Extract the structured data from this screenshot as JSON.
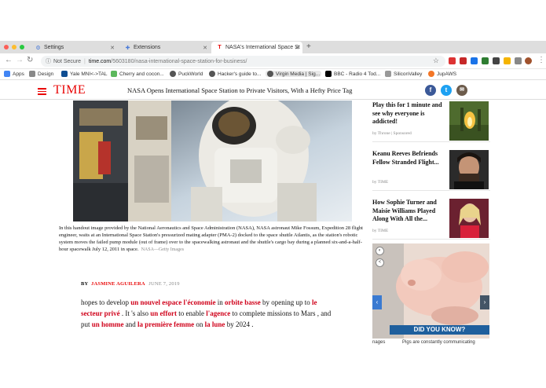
{
  "browser": {
    "tabs": [
      {
        "label": "Settings",
        "icon": "gear-icon"
      },
      {
        "label": "Extensions",
        "icon": "puzzle-icon"
      },
      {
        "label": "NASA's International Space St",
        "icon": "time-favicon"
      }
    ],
    "new_tab_label": "+",
    "address": {
      "security": "Not Secure",
      "host": "time.com",
      "path": "/5603180/nasa-international-space-station-for-business/"
    },
    "bookmarks": [
      "Apps",
      "Design",
      "Yale MNI<->TAL",
      "Cherry and cocon...",
      "PuckWorld",
      "Hacker's guide to...",
      "Virgin Media | Sig...",
      "BBC - Radio 4 Tod...",
      "SiliconValley",
      "JupAWS"
    ]
  },
  "site": {
    "logo": "TIME",
    "headline": "NASA Opens International Space Station to Private Visitors, With a Hefty Price Tag",
    "social": {
      "facebook": "f",
      "twitter": "t",
      "email": "✉"
    },
    "colors": {
      "brand": "#e90606",
      "highlight": "#d0021b",
      "facebook": "#3b5998",
      "twitter": "#1da1f2",
      "email": "#6d5c4c"
    }
  },
  "article": {
    "caption": "In this handout image provided by the National Aeronautics and Space Administration (NASA), NASA astronaut Mike Fossum, Expedition 28 flight engineer, waits at an International Space Station's pressurized mating adapter (PMA-2) docked to the space shuttle Atlantis, as the station's robotic system moves the failed pump module (out of frame) over to the spacewalking astronaut and the shuttle's cargo bay during a planned six-and-a-half-hour spacewalk July 12, 2011 in space.",
    "caption_credit": "NASA—Getty Images",
    "by": "BY",
    "author": "JASMINE AGUILERA",
    "date": "JUNE 7, 2019",
    "body": {
      "t1": "hopes to develop ",
      "h1": "un nouvel espace l'économie",
      "t2": " in ",
      "h2": "orbite basse",
      "t3": " by opening up to ",
      "h3": "le secteur privé",
      "t4": " . It 's also ",
      "h4": "un effort",
      "t5": " to enable ",
      "h5": "l'agence",
      "t6": " to complete missions to Mars , and put ",
      "h6": "un homme",
      "t7": " and ",
      "h7": "la première femme",
      "t8": " on ",
      "h8": "la lune",
      "t9": " by 2024 ."
    }
  },
  "sidebar": {
    "items": [
      {
        "title": "Play this for 1 minute and see why everyone is addicted!",
        "source": "by Throne | Sponsored"
      },
      {
        "title": "Keanu Reeves Befriends Fellow Stranded Flight...",
        "source": "by TIME"
      },
      {
        "title": "How Sophie Turner and Maisie Williams Played Along With All the...",
        "source": "by TIME"
      }
    ],
    "ad": {
      "headline": "DID YOU KNOW?",
      "text_left": "nages",
      "text": "Pigs are constantly communicating"
    }
  }
}
